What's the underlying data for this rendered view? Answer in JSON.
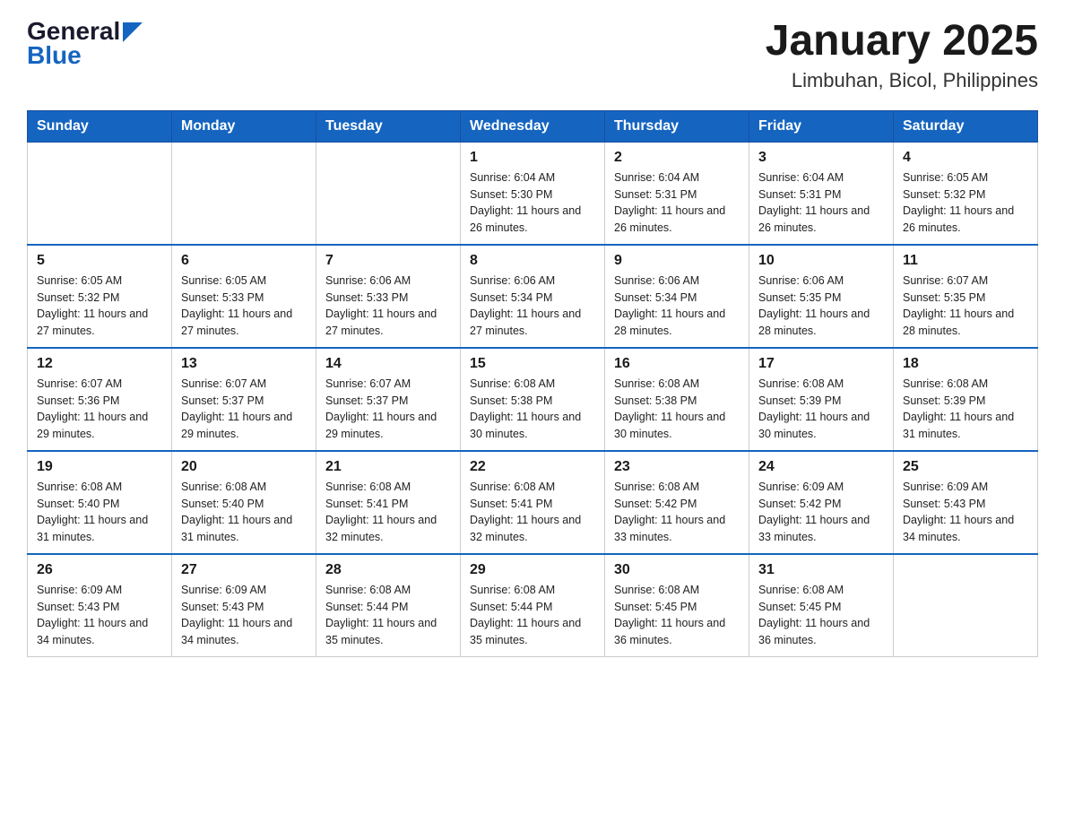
{
  "logo": {
    "general": "General",
    "blue": "Blue"
  },
  "title": "January 2025",
  "subtitle": "Limbuhan, Bicol, Philippines",
  "days_of_week": [
    "Sunday",
    "Monday",
    "Tuesday",
    "Wednesday",
    "Thursday",
    "Friday",
    "Saturday"
  ],
  "weeks": [
    [
      {
        "day": "",
        "info": ""
      },
      {
        "day": "",
        "info": ""
      },
      {
        "day": "",
        "info": ""
      },
      {
        "day": "1",
        "info": "Sunrise: 6:04 AM\nSunset: 5:30 PM\nDaylight: 11 hours and 26 minutes."
      },
      {
        "day": "2",
        "info": "Sunrise: 6:04 AM\nSunset: 5:31 PM\nDaylight: 11 hours and 26 minutes."
      },
      {
        "day": "3",
        "info": "Sunrise: 6:04 AM\nSunset: 5:31 PM\nDaylight: 11 hours and 26 minutes."
      },
      {
        "day": "4",
        "info": "Sunrise: 6:05 AM\nSunset: 5:32 PM\nDaylight: 11 hours and 26 minutes."
      }
    ],
    [
      {
        "day": "5",
        "info": "Sunrise: 6:05 AM\nSunset: 5:32 PM\nDaylight: 11 hours and 27 minutes."
      },
      {
        "day": "6",
        "info": "Sunrise: 6:05 AM\nSunset: 5:33 PM\nDaylight: 11 hours and 27 minutes."
      },
      {
        "day": "7",
        "info": "Sunrise: 6:06 AM\nSunset: 5:33 PM\nDaylight: 11 hours and 27 minutes."
      },
      {
        "day": "8",
        "info": "Sunrise: 6:06 AM\nSunset: 5:34 PM\nDaylight: 11 hours and 27 minutes."
      },
      {
        "day": "9",
        "info": "Sunrise: 6:06 AM\nSunset: 5:34 PM\nDaylight: 11 hours and 28 minutes."
      },
      {
        "day": "10",
        "info": "Sunrise: 6:06 AM\nSunset: 5:35 PM\nDaylight: 11 hours and 28 minutes."
      },
      {
        "day": "11",
        "info": "Sunrise: 6:07 AM\nSunset: 5:35 PM\nDaylight: 11 hours and 28 minutes."
      }
    ],
    [
      {
        "day": "12",
        "info": "Sunrise: 6:07 AM\nSunset: 5:36 PM\nDaylight: 11 hours and 29 minutes."
      },
      {
        "day": "13",
        "info": "Sunrise: 6:07 AM\nSunset: 5:37 PM\nDaylight: 11 hours and 29 minutes."
      },
      {
        "day": "14",
        "info": "Sunrise: 6:07 AM\nSunset: 5:37 PM\nDaylight: 11 hours and 29 minutes."
      },
      {
        "day": "15",
        "info": "Sunrise: 6:08 AM\nSunset: 5:38 PM\nDaylight: 11 hours and 30 minutes."
      },
      {
        "day": "16",
        "info": "Sunrise: 6:08 AM\nSunset: 5:38 PM\nDaylight: 11 hours and 30 minutes."
      },
      {
        "day": "17",
        "info": "Sunrise: 6:08 AM\nSunset: 5:39 PM\nDaylight: 11 hours and 30 minutes."
      },
      {
        "day": "18",
        "info": "Sunrise: 6:08 AM\nSunset: 5:39 PM\nDaylight: 11 hours and 31 minutes."
      }
    ],
    [
      {
        "day": "19",
        "info": "Sunrise: 6:08 AM\nSunset: 5:40 PM\nDaylight: 11 hours and 31 minutes."
      },
      {
        "day": "20",
        "info": "Sunrise: 6:08 AM\nSunset: 5:40 PM\nDaylight: 11 hours and 31 minutes."
      },
      {
        "day": "21",
        "info": "Sunrise: 6:08 AM\nSunset: 5:41 PM\nDaylight: 11 hours and 32 minutes."
      },
      {
        "day": "22",
        "info": "Sunrise: 6:08 AM\nSunset: 5:41 PM\nDaylight: 11 hours and 32 minutes."
      },
      {
        "day": "23",
        "info": "Sunrise: 6:08 AM\nSunset: 5:42 PM\nDaylight: 11 hours and 33 minutes."
      },
      {
        "day": "24",
        "info": "Sunrise: 6:09 AM\nSunset: 5:42 PM\nDaylight: 11 hours and 33 minutes."
      },
      {
        "day": "25",
        "info": "Sunrise: 6:09 AM\nSunset: 5:43 PM\nDaylight: 11 hours and 34 minutes."
      }
    ],
    [
      {
        "day": "26",
        "info": "Sunrise: 6:09 AM\nSunset: 5:43 PM\nDaylight: 11 hours and 34 minutes."
      },
      {
        "day": "27",
        "info": "Sunrise: 6:09 AM\nSunset: 5:43 PM\nDaylight: 11 hours and 34 minutes."
      },
      {
        "day": "28",
        "info": "Sunrise: 6:08 AM\nSunset: 5:44 PM\nDaylight: 11 hours and 35 minutes."
      },
      {
        "day": "29",
        "info": "Sunrise: 6:08 AM\nSunset: 5:44 PM\nDaylight: 11 hours and 35 minutes."
      },
      {
        "day": "30",
        "info": "Sunrise: 6:08 AM\nSunset: 5:45 PM\nDaylight: 11 hours and 36 minutes."
      },
      {
        "day": "31",
        "info": "Sunrise: 6:08 AM\nSunset: 5:45 PM\nDaylight: 11 hours and 36 minutes."
      },
      {
        "day": "",
        "info": ""
      }
    ]
  ]
}
